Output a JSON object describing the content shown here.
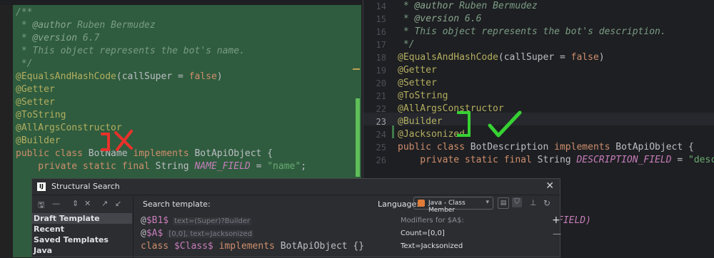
{
  "left_editor": {
    "lines": [
      [
        {
          "t": "/**",
          "c": "cm"
        }
      ],
      [
        {
          "t": " * ",
          "c": "cm"
        },
        {
          "t": "@author",
          "c": "cm-tag"
        },
        {
          "t": " Ruben Bermudez",
          "c": "cm"
        }
      ],
      [
        {
          "t": " * ",
          "c": "cm"
        },
        {
          "t": "@version",
          "c": "cm-tag"
        },
        {
          "t": " 6.7",
          "c": "cm"
        }
      ],
      [
        {
          "t": " * This object represents the bot's name.",
          "c": "cm"
        }
      ],
      [
        {
          "t": " */",
          "c": "cm"
        }
      ],
      [
        {
          "t": "@EqualsAndHashCode",
          "c": "ann"
        },
        {
          "t": "(callSuper = ",
          "c": "pl"
        },
        {
          "t": "false",
          "c": "kw"
        },
        {
          "t": ")",
          "c": "pl"
        }
      ],
      [
        {
          "t": "@Getter",
          "c": "ann"
        }
      ],
      [
        {
          "t": "@Setter",
          "c": "ann"
        }
      ],
      [
        {
          "t": "@ToString",
          "c": "ann"
        }
      ],
      [
        {
          "t": "@AllArgsConstructor",
          "c": "ann"
        }
      ],
      [
        {
          "t": "@Builder",
          "c": "ann"
        }
      ],
      [
        {
          "t": "public class ",
          "c": "kw"
        },
        {
          "t": "BotName ",
          "c": "pl"
        },
        {
          "t": "implements ",
          "c": "kw"
        },
        {
          "t": "BotApiObject {",
          "c": "pl"
        }
      ],
      [
        {
          "t": "    private static final ",
          "c": "kw"
        },
        {
          "t": "String ",
          "c": "pl"
        },
        {
          "t": "NAME_FIELD",
          "c": "fld"
        },
        {
          "t": " = ",
          "c": "pl"
        },
        {
          "t": "\"name\"",
          "c": "str"
        },
        {
          "t": ";",
          "c": "pl"
        }
      ]
    ]
  },
  "right_editor": {
    "line_numbers": [
      "14",
      "15",
      "16",
      "17",
      "18",
      "19",
      "20",
      "21",
      "22",
      "23",
      "24",
      "25",
      "26"
    ],
    "current_line": "23",
    "lines": [
      [
        {
          "t": " * ",
          "c": "cm"
        },
        {
          "t": "@author",
          "c": "cm-tag"
        },
        {
          "t": " Ruben Bermudez",
          "c": "cm"
        }
      ],
      [
        {
          "t": " * ",
          "c": "cm"
        },
        {
          "t": "@version",
          "c": "cm-tag"
        },
        {
          "t": " 6.6",
          "c": "cm"
        }
      ],
      [
        {
          "t": " * This object represents the bot's description.",
          "c": "cm"
        }
      ],
      [
        {
          "t": " */",
          "c": "cm"
        }
      ],
      [
        {
          "t": "@EqualsAndHashCode",
          "c": "ann"
        },
        {
          "t": "(callSuper = ",
          "c": "pl"
        },
        {
          "t": "false",
          "c": "kw"
        },
        {
          "t": ")",
          "c": "pl"
        }
      ],
      [
        {
          "t": "@Getter",
          "c": "ann"
        }
      ],
      [
        {
          "t": "@Setter",
          "c": "ann"
        }
      ],
      [
        {
          "t": "@ToString",
          "c": "ann"
        }
      ],
      [
        {
          "t": "@AllArgsConstructor",
          "c": "ann"
        }
      ],
      [
        {
          "t": "@Builder",
          "c": "ann"
        }
      ],
      [
        {
          "t": "@Jacksonized",
          "c": "ann"
        }
      ],
      [
        {
          "t": "public class ",
          "c": "kw"
        },
        {
          "t": "BotDescription ",
          "c": "pl"
        },
        {
          "t": "implements ",
          "c": "kw"
        },
        {
          "t": "BotApiObject {",
          "c": "pl"
        }
      ],
      [
        {
          "t": "    private static final ",
          "c": "kw"
        },
        {
          "t": "String ",
          "c": "pl"
        },
        {
          "t": "DESCRIPTION_FIELD",
          "c": "fld"
        },
        {
          "t": " = ",
          "c": "pl"
        },
        {
          "t": "\"descrip",
          "c": "str"
        }
      ]
    ],
    "partial_bottom_text": "FIELD)"
  },
  "dialog": {
    "title": "Structural Search",
    "logo_text": "IJ",
    "close_glyph": "✕",
    "draft_items": [
      {
        "label": "Draft Template",
        "selected": true
      },
      {
        "label": "Recent",
        "selected": false
      },
      {
        "label": "Saved Templates",
        "selected": false
      },
      {
        "label": "Java",
        "selected": false
      }
    ],
    "search_template_label": "Search template:",
    "language_label": "Language:",
    "language_value": "Java - Class Member",
    "template_lines": [
      {
        "parts": [
          {
            "t": "@",
            "c": "pl"
          },
          {
            "t": "$B1$",
            "c": "var"
          }
        ],
        "hint": "text=(Super)?Builder"
      },
      {
        "parts": [
          {
            "t": "@",
            "c": "pl"
          },
          {
            "t": "$A$",
            "c": "var"
          }
        ],
        "hint": "[0,0], text=Jacksonized"
      },
      {
        "parts": [
          {
            "t": "class ",
            "c": "kw"
          },
          {
            "t": "$Class$",
            "c": "var"
          },
          {
            "t": " implements ",
            "c": "kw"
          },
          {
            "t": "BotApiObject {}",
            "c": "pl"
          }
        ],
        "hint": ""
      }
    ],
    "modifiers_title": "Modifiers for $A$:",
    "modifiers": [
      "Count=[0,0]",
      "Text=Jacksonized"
    ]
  },
  "colors": {
    "left_highlight": "#2f5c3e",
    "annotation_red": "#e8312b",
    "annotation_green": "#37d133"
  }
}
